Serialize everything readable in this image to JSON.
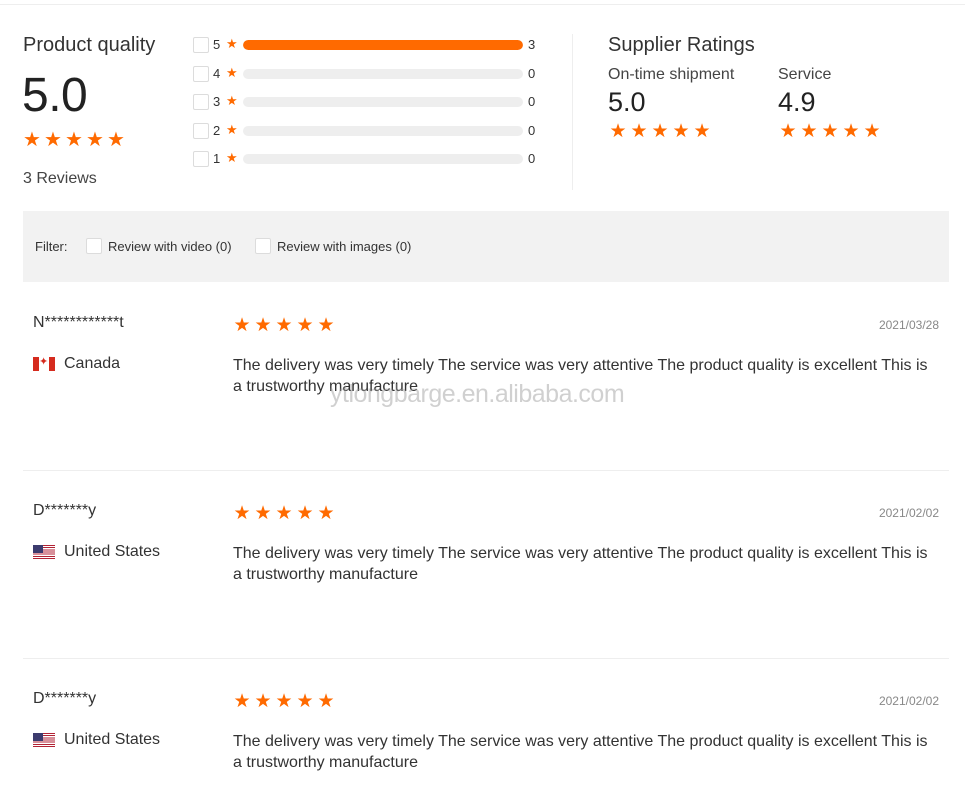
{
  "product_quality": {
    "title": "Product quality",
    "score": "5.0",
    "stars": 5,
    "reviews_label": "3 Reviews",
    "distribution": [
      {
        "stars": "5",
        "count": "3",
        "fill": 1.0
      },
      {
        "stars": "4",
        "count": "0",
        "fill": 0
      },
      {
        "stars": "3",
        "count": "0",
        "fill": 0
      },
      {
        "stars": "2",
        "count": "0",
        "fill": 0
      },
      {
        "stars": "1",
        "count": "0",
        "fill": 0
      }
    ]
  },
  "supplier_ratings": {
    "title": "Supplier Ratings",
    "on_time": {
      "label": "On-time shipment",
      "score": "5.0",
      "stars": 5
    },
    "service": {
      "label": "Service",
      "score": "4.9",
      "stars": 5
    }
  },
  "filter": {
    "label": "Filter:",
    "video_option": "Review with video (0)",
    "images_option": "Review with images (0)"
  },
  "reviews": [
    {
      "name": "N************t",
      "country": "Canada",
      "flag": "canada-flag",
      "date": "2021/03/28",
      "stars": 5,
      "text": "The delivery was very timely The service was very attentive The product quality is excellent   This is a trustworthy manufacture"
    },
    {
      "name": "D*******y",
      "country": "United States",
      "flag": "us-flag",
      "date": "2021/02/02",
      "stars": 5,
      "text": "The delivery was very timely The service was very attentive The product quality is excellent   This is a trustworthy manufacture"
    },
    {
      "name": "D*******y",
      "country": "United States",
      "flag": "us-flag",
      "date": "2021/02/02",
      "stars": 5,
      "text": "The delivery was very timely The service was very attentive The product quality is excellent   This is a trustworthy manufacture"
    }
  ],
  "watermark": "ytlongbarge.en.alibaba.com",
  "colors": {
    "accent": "#ff6a00",
    "track": "#eeeeee",
    "filter_bg": "#f2f2f2"
  }
}
